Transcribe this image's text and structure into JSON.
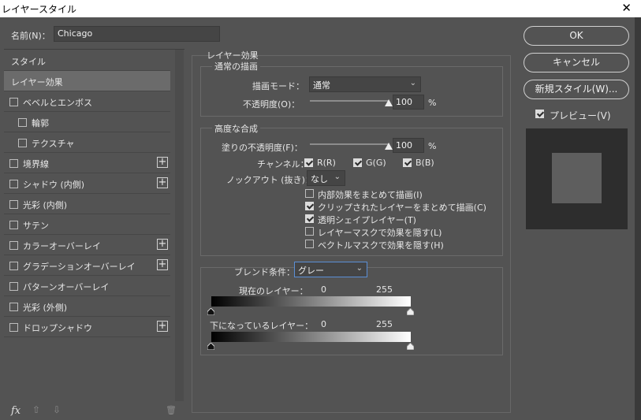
{
  "window": {
    "title": "レイヤースタイル",
    "close": "✕"
  },
  "name_field": {
    "label": "名前(N)：",
    "value": "Chicago"
  },
  "left_panel": {
    "items": [
      {
        "label": "スタイル",
        "checkbox": false,
        "checked": false,
        "plus": false,
        "selected": false,
        "indent": false
      },
      {
        "label": "レイヤー効果",
        "checkbox": false,
        "checked": false,
        "plus": false,
        "selected": true,
        "indent": false
      },
      {
        "label": "ベベルとエンボス",
        "checkbox": true,
        "checked": false,
        "plus": false,
        "selected": false,
        "indent": false
      },
      {
        "label": "輪郭",
        "checkbox": true,
        "checked": false,
        "plus": false,
        "selected": false,
        "indent": true
      },
      {
        "label": "テクスチャ",
        "checkbox": true,
        "checked": false,
        "plus": false,
        "selected": false,
        "indent": true
      },
      {
        "label": "境界線",
        "checkbox": true,
        "checked": false,
        "plus": true,
        "selected": false,
        "indent": false
      },
      {
        "label": "シャドウ (内側)",
        "checkbox": true,
        "checked": false,
        "plus": true,
        "selected": false,
        "indent": false
      },
      {
        "label": "光彩 (内側)",
        "checkbox": true,
        "checked": false,
        "plus": false,
        "selected": false,
        "indent": false
      },
      {
        "label": "サテン",
        "checkbox": true,
        "checked": false,
        "plus": false,
        "selected": false,
        "indent": false
      },
      {
        "label": "カラーオーバーレイ",
        "checkbox": true,
        "checked": false,
        "plus": true,
        "selected": false,
        "indent": false
      },
      {
        "label": "グラデーションオーバーレイ",
        "checkbox": true,
        "checked": false,
        "plus": true,
        "selected": false,
        "indent": false
      },
      {
        "label": "パターンオーバーレイ",
        "checkbox": true,
        "checked": false,
        "plus": false,
        "selected": false,
        "indent": false
      },
      {
        "label": "光彩 (外側)",
        "checkbox": true,
        "checked": false,
        "plus": false,
        "selected": false,
        "indent": false
      },
      {
        "label": "ドロップシャドウ",
        "checkbox": true,
        "checked": false,
        "plus": true,
        "selected": false,
        "indent": false
      }
    ],
    "footer": {
      "fx": "fx",
      "up": "⇧",
      "down": "⇩",
      "trash": "🗑"
    }
  },
  "main": {
    "section_title": "レイヤー効果",
    "normal_blend": {
      "title": "通常の描画",
      "blend_mode_label": "描画モード：",
      "blend_mode_value": "通常",
      "opacity_label": "不透明度(O)：",
      "opacity_value": "100",
      "opacity_unit": "%",
      "opacity_level": 1.0
    },
    "advanced_blend": {
      "title": "高度な合成",
      "fill_opacity_label": "塗りの不透明度(F)：",
      "fill_opacity_value": "100",
      "fill_opacity_unit": "%",
      "fill_opacity_level": 1.0,
      "channels_label": "チャンネル：",
      "channels": [
        {
          "label": "R(R)",
          "checked": true
        },
        {
          "label": "G(G)",
          "checked": true
        },
        {
          "label": "B(B)",
          "checked": true
        }
      ],
      "knockout_label": "ノックアウト (抜き)：",
      "knockout_value": "なし",
      "options": [
        {
          "label": "内部効果をまとめて描画(I)",
          "checked": false
        },
        {
          "label": "クリップされたレイヤーをまとめて描画(C)",
          "checked": true
        },
        {
          "label": "透明シェイプレイヤー(T)",
          "checked": true
        },
        {
          "label": "レイヤーマスクで効果を隠す(L)",
          "checked": false
        },
        {
          "label": "ベクトルマスクで効果を隠す(H)",
          "checked": false
        }
      ]
    },
    "blend_if": {
      "label": "ブレンド条件：",
      "value": "グレー",
      "this_layer_label": "現在のレイヤー：",
      "this_layer_min": "0",
      "this_layer_max": "255",
      "underlying_label": "下になっているレイヤー：",
      "underlying_min": "0",
      "underlying_max": "255"
    }
  },
  "buttons": {
    "ok": "OK",
    "cancel": "キャンセル",
    "new_style": "新規スタイル(W)...",
    "preview_label": "プレビュー(V)",
    "preview_checked": true
  }
}
